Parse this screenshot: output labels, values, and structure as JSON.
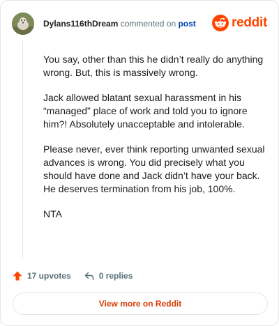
{
  "header": {
    "username": "Dylans116thDream",
    "action_text": "commented on",
    "post_link_label": "post",
    "avatar_icon": "user-avatar",
    "brand_icon": "reddit-snoo-icon",
    "brand_name": "reddit"
  },
  "comment": {
    "paragraphs": [
      "You say, other than this he didn’t really do anything wrong. But, this is massively wrong.",
      "Jack allowed blatant sexual harassment in his “managed” place of work and told you to ignore him?! Absolutely unacceptable and intolerable.",
      "Please never, ever think reporting unwanted sexual advances is wrong. You did precisely what you should have done and Jack didn’t have your back. He deserves termination from his job, 100%.",
      "NTA"
    ]
  },
  "actions": {
    "upvotes_label": "17 upvotes",
    "replies_label": "0 replies",
    "upvote_icon": "upvote-arrow-icon",
    "reply_icon": "reply-arrow-icon"
  },
  "footer": {
    "view_more_label": "View more on Reddit"
  },
  "colors": {
    "brand": "#ff4500",
    "link": "#0045ac",
    "muted": "#576f76",
    "cta": "#d93a00",
    "border": "#e3e5e8"
  }
}
